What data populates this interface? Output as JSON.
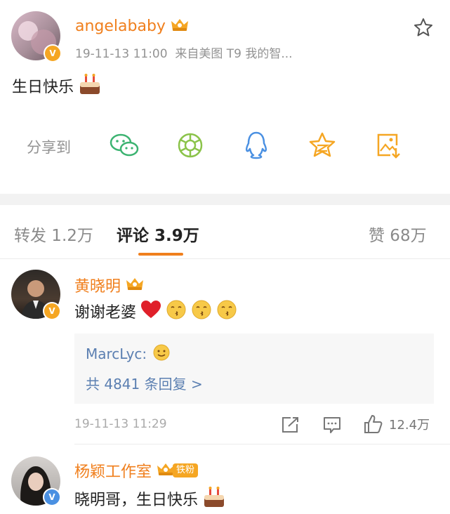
{
  "post": {
    "author": "angelababy",
    "meta": "19-11-13 11:00  来自美图 T9 我的智...",
    "text": "生日快乐",
    "share_label": "分享到"
  },
  "tabs": {
    "repost": "转发 1.2万",
    "comments": "评论 3.9万",
    "likes": "赞 68万"
  },
  "comments": [
    {
      "author": "黄晓明",
      "text": "谢谢老婆",
      "reply_author": "MarcLyc:",
      "reply_more": "共 4841 条回复 >",
      "time": "19-11-13 11:29",
      "likes": "12.4万"
    },
    {
      "author": "杨颖工作室",
      "fan_badge": "铁粉",
      "text": "晓明哥，生日快乐"
    }
  ],
  "colors": {
    "name_orange": "#f07f1d",
    "link_blue": "#5b7fb1",
    "tab_underline": "#f07f1d",
    "verified_orange": "#f5a623",
    "verified_blue": "#4a90e2"
  },
  "icons": [
    "star-icon",
    "wechat-icon",
    "moments-icon",
    "qq-icon",
    "qzone-icon",
    "save-image-icon",
    "cake-emoji",
    "heart-emoji",
    "kiss-emoji",
    "smile-emoji",
    "share-action-icon",
    "comment-action-icon",
    "like-icon",
    "crown-icon",
    "verified-badge-icon"
  ]
}
